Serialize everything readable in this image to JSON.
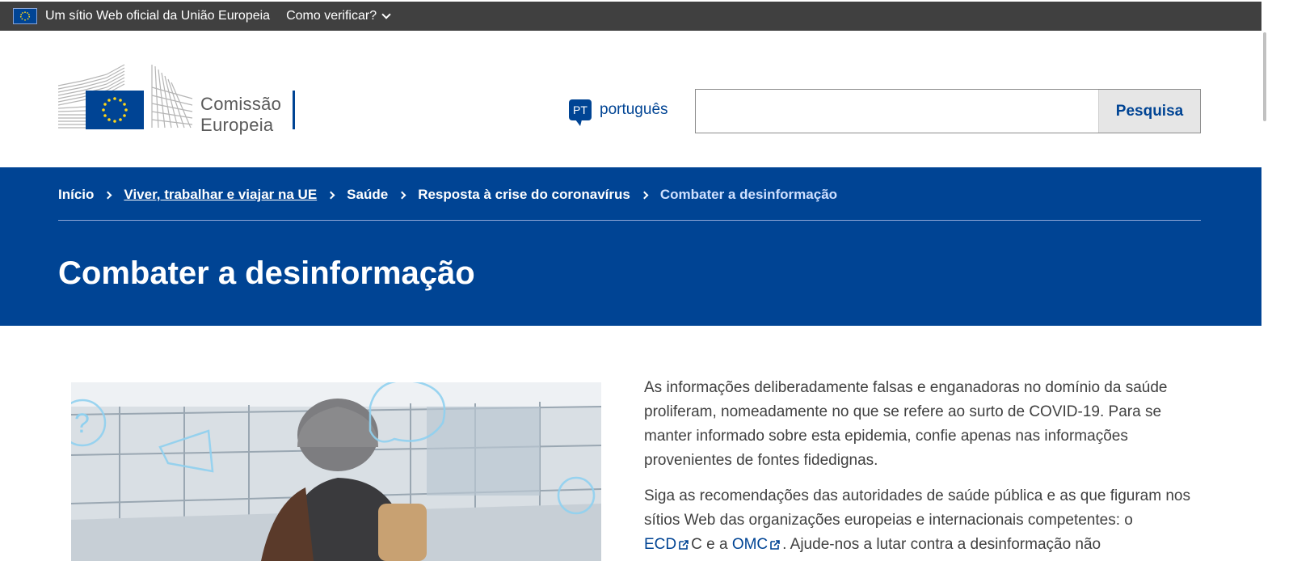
{
  "topbar": {
    "official_text": "Um sítio Web oficial da União Europeia",
    "verify_label": "Como verificar?"
  },
  "header": {
    "logo_line1": "Comissão",
    "logo_line2": "Europeia",
    "language_code": "PT",
    "language_label": "português",
    "search_value": "",
    "search_button": "Pesquisa"
  },
  "breadcrumb": {
    "items": [
      "Início",
      "Viver, trabalhar e viajar na UE",
      "Saúde",
      "Resposta à crise do coronavírus",
      "Combater a desinformação"
    ]
  },
  "page": {
    "title": "Combater a desinformação"
  },
  "content": {
    "p1": "As informações deliberadamente falsas e enganadoras no domínio da saúde proliferam, nomeadamente no que se refere ao surto de COVID-19. Para se manter informado sobre esta epidemia, confie apenas nas informações provenientes de fontes fidedignas.",
    "p2_start": "Siga as recomendações das autoridades de saúde pública e as que figuram nos sítios Web das organizações europeias e internacionais competentes: o",
    "link_ecdc_a": "ECD",
    "link_ecdc_b": "C e a",
    "link_omc": "OMC",
    "p2_end": ". Ajude-nos a lutar contra a desinformação não"
  },
  "colors": {
    "eu_blue": "#004494",
    "topbar_gray": "#404040",
    "eu_yellow": "#ffd617"
  }
}
